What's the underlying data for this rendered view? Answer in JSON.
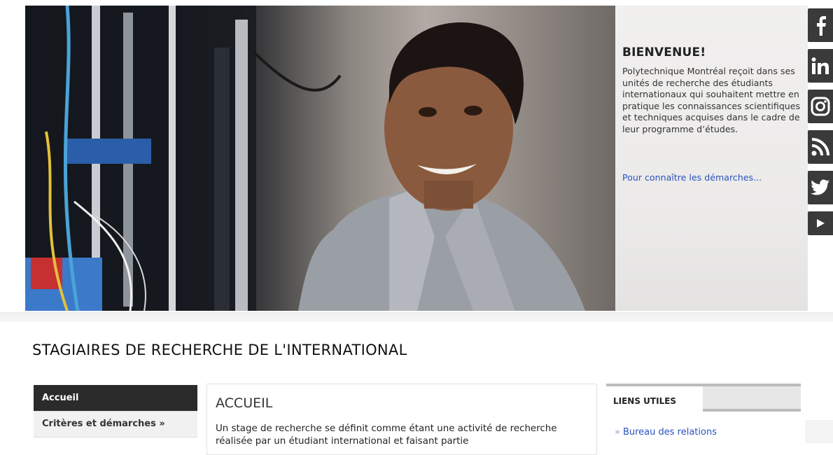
{
  "hero": {
    "welcome_title": "BIENVENUE!",
    "welcome_text": "Polytechnique Montréal reçoit dans ses unités de recherche des étudiants internationaux qui souhaitent mettre en pratique les connaissances scientifiques et techniques acquises dans le cadre de leur programme d’études.",
    "welcome_link": "Pour connaître les démarches..."
  },
  "social": {
    "icons": [
      "facebook-icon",
      "linkedin-icon",
      "instagram-icon",
      "rss-icon",
      "twitter-icon",
      "youtube-icon"
    ]
  },
  "page": {
    "title": "STAGIAIRES DE RECHERCHE DE L'INTERNATIONAL"
  },
  "nav": {
    "items": [
      {
        "label": "Accueil"
      },
      {
        "label": "Critères et démarches »"
      }
    ]
  },
  "content": {
    "title": "ACCUEIL",
    "text": "Un stage de recherche se définit comme étant une activité de recherche réalisée par un étudiant international et faisant partie"
  },
  "links": {
    "title": "LIENS UTILES",
    "items": [
      {
        "label": "Bureau des relations"
      }
    ]
  },
  "colors": {
    "link": "#2a52be",
    "nav_active": "#2b2b2b",
    "social_bg": "#3a3a3a"
  }
}
